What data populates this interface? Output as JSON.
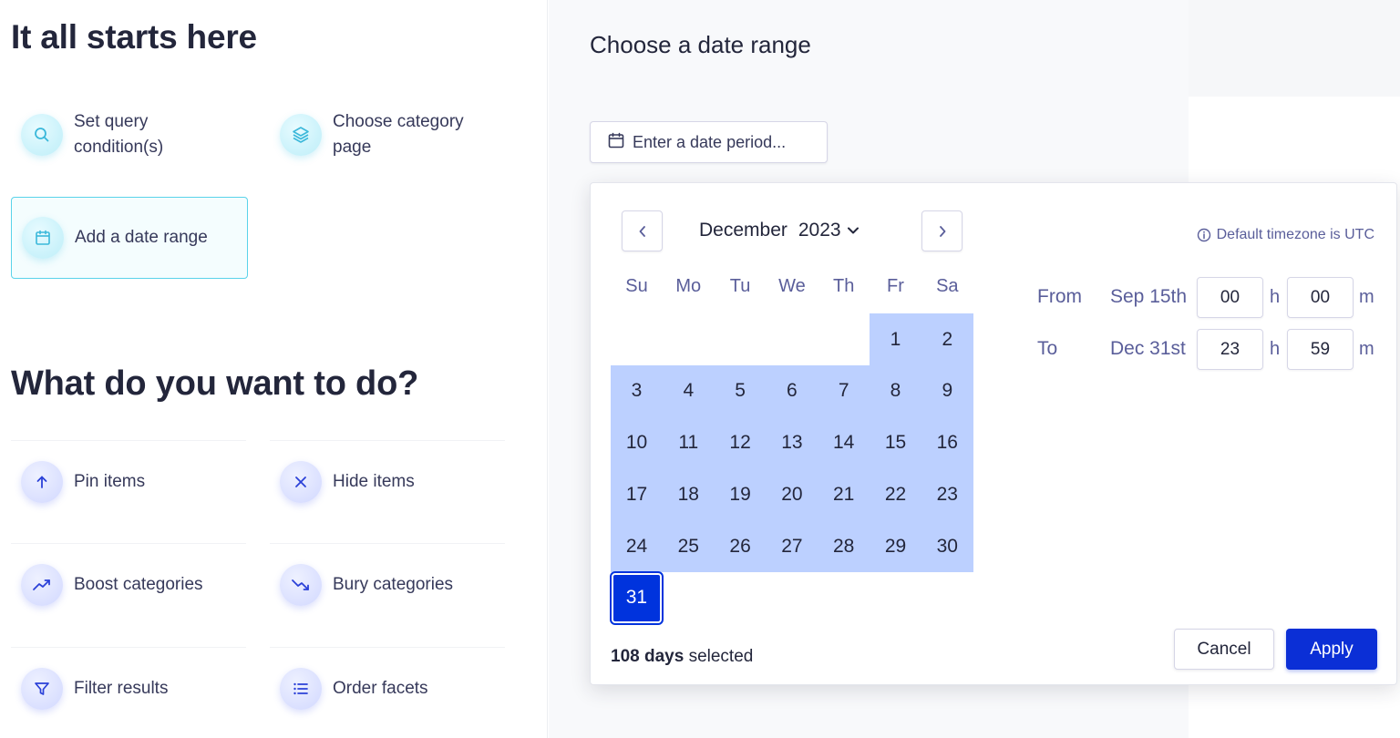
{
  "left": {
    "heading_start": "It all starts here",
    "start_cards": [
      {
        "label_line1": "Set query",
        "label_line2": "condition(s)",
        "icon": "search-icon"
      },
      {
        "label_line1": "Choose category",
        "label_line2": "page",
        "icon": "layers-icon"
      },
      {
        "label": "Add a date range",
        "icon": "calendar-icon"
      }
    ],
    "heading_actions": "What do you want to do?",
    "actions": [
      {
        "label": "Pin items",
        "icon": "arrow-up-icon"
      },
      {
        "label": "Hide items",
        "icon": "close-icon"
      },
      {
        "label": "Boost categories",
        "icon": "trend-up-icon"
      },
      {
        "label": "Bury categories",
        "icon": "trend-down-icon"
      },
      {
        "label": "Filter results",
        "icon": "filter-icon"
      },
      {
        "label": "Order facets",
        "icon": "list-icon"
      }
    ]
  },
  "right": {
    "title": "Choose a date range",
    "date_input_placeholder": "Enter a date period..."
  },
  "calendar": {
    "month": "December",
    "year": "2023",
    "timezone_note": "Default timezone is UTC",
    "weekdays": [
      "Su",
      "Mo",
      "Tu",
      "We",
      "Th",
      "Fr",
      "Sa"
    ],
    "first_weekday_index": 5,
    "days_in_month": 31,
    "range_start_day": 1,
    "range_end_day": 31,
    "selected_day": 31,
    "from": {
      "label": "From",
      "date": "Sep 15th",
      "hour": "00",
      "minute": "00"
    },
    "to": {
      "label": "To",
      "date": "Dec 31st",
      "hour": "23",
      "minute": "59"
    },
    "hour_unit": "h",
    "minute_unit": "m",
    "days_selected_count": "108 days",
    "days_selected_suffix": " selected",
    "cancel_label": "Cancel",
    "apply_label": "Apply"
  },
  "colors": {
    "accent": "#0b2fd6",
    "range_fill": "#bcd0ff",
    "selected_day": "#0033dd",
    "active_card_border": "#5ad3ea",
    "muted_text": "#5a5e9a"
  }
}
